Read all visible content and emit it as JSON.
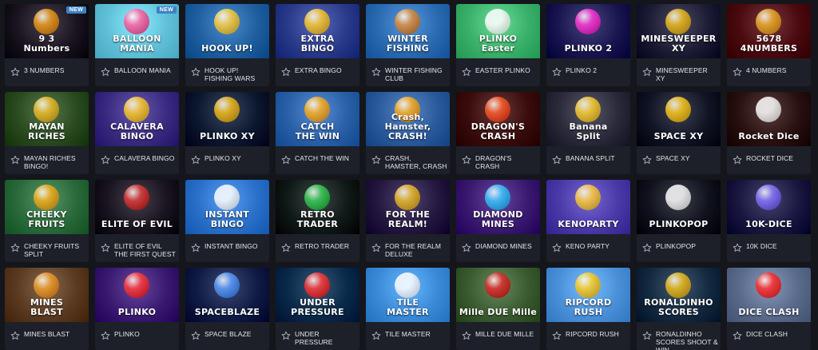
{
  "games": [
    {
      "label": "3 NUMBERS",
      "art": "9 3\nNumbers",
      "badge": "NEW",
      "bg": "#1a1420",
      "accent": "#f0a020"
    },
    {
      "label": "BALLOON MANIA",
      "art": "BALLOON\nMANIA",
      "badge": "NEW",
      "bg": "#5fc0d8",
      "accent": "#ff5fa0"
    },
    {
      "label": "HOOK UP! FISHING WARS",
      "art": "HOOK UP!",
      "badge": "",
      "bg": "#1f5fa0",
      "accent": "#ffd040"
    },
    {
      "label": "EXTRA BINGO",
      "art": "EXTRA\nBINGO",
      "badge": "",
      "bg": "#2a3a8a",
      "accent": "#ffcc30"
    },
    {
      "label": "WINTER FISHING CLUB",
      "art": "WINTER\nFISHING",
      "badge": "",
      "bg": "#2a6ab0",
      "accent": "#e09040"
    },
    {
      "label": "EASTER PLINKO",
      "art": "PLINKO\nEaster",
      "badge": "",
      "bg": "#3ab06a",
      "accent": "#ffffff"
    },
    {
      "label": "PLINKO 2",
      "art": "PLINKO 2",
      "badge": "",
      "bg": "#1a1650",
      "accent": "#ff3fd8"
    },
    {
      "label": "MINESWEEPER XY",
      "art": "MINESWEEPER XY",
      "badge": "",
      "bg": "#1c1c34",
      "accent": "#f0c020"
    },
    {
      "label": "4 NUMBERS",
      "art": "5678\n4NUMBERS",
      "badge": "",
      "bg": "#4a0a10",
      "accent": "#f0b030"
    },
    {
      "label": "MAYAN RICHES BINGO!",
      "art": "MAYAN\nRICHES",
      "badge": "",
      "bg": "#2a4a20",
      "accent": "#f0c030"
    },
    {
      "label": "CALAVERA BINGO",
      "art": "CALAVERA\nBINGO",
      "badge": "",
      "bg": "#3a2a80",
      "accent": "#ffcf30"
    },
    {
      "label": "PLINKO XY",
      "art": "PLINKO XY",
      "badge": "",
      "bg": "#0c1830",
      "accent": "#f5c020"
    },
    {
      "label": "CATCH THE WIN",
      "art": "CATCH\nTHE WIN",
      "badge": "",
      "bg": "#2a60a8",
      "accent": "#ffb020"
    },
    {
      "label": "CRASH, HAMSTER, CRASH",
      "art": "Crash, Hamster,\nCRASH!",
      "badge": "",
      "bg": "#2a5a9a",
      "accent": "#ffb020"
    },
    {
      "label": "DRAGON'S CRASH",
      "art": "DRAGON'S CRASH",
      "badge": "",
      "bg": "#3a0c0c",
      "accent": "#ff6030"
    },
    {
      "label": "BANANA SPLIT",
      "art": "Banana\nSplit",
      "badge": "",
      "bg": "#2a2a3a",
      "accent": "#ffd23a"
    },
    {
      "label": "SPACE XY",
      "art": "SPACE XY",
      "badge": "",
      "bg": "#101424",
      "accent": "#ffcc20"
    },
    {
      "label": "ROCKET DICE",
      "art": "Rocket Dice",
      "badge": "",
      "bg": "#2a1010",
      "accent": "#ffffff"
    },
    {
      "label": "CHEEKY FRUITS SPLIT",
      "art": "CHEEKY\nFRUITS",
      "badge": "",
      "bg": "#2a6a3a",
      "accent": "#f5b020"
    },
    {
      "label": "ELITE OF EVIL THE FIRST QUEST",
      "art": "ELITE OF EVIL",
      "badge": "",
      "bg": "#1a1420",
      "accent": "#e04040"
    },
    {
      "label": "INSTANT BINGO",
      "art": "INSTANT\nBINGO",
      "badge": "",
      "bg": "#2a70c8",
      "accent": "#ffffff"
    },
    {
      "label": "RETRO TRADER",
      "art": "RETRO\nTRADER",
      "badge": "",
      "bg": "#101a18",
      "accent": "#40d060"
    },
    {
      "label": "FOR THE REALM DELUXE",
      "art": "FOR THE\nREALM!",
      "badge": "",
      "bg": "#241840",
      "accent": "#f0c030"
    },
    {
      "label": "DIAMOND MINES",
      "art": "DIAMOND\nMINES",
      "badge": "",
      "bg": "#3a1a70",
      "accent": "#40c8ff"
    },
    {
      "label": "KENO PARTY",
      "art": "KENOPARTY",
      "badge": "",
      "bg": "#4a3aa8",
      "accent": "#ffd040"
    },
    {
      "label": "PLINKOPOP",
      "art": "PLINKOPOP",
      "badge": "",
      "bg": "#10121e",
      "accent": "#ffffff"
    },
    {
      "label": "10K DICE",
      "art": "10K-DICE",
      "badge": "",
      "bg": "#1a1840",
      "accent": "#8a7aff"
    },
    {
      "label": "MINES BLAST",
      "art": "MINES\nBLAST",
      "badge": "",
      "bg": "#5a3a20",
      "accent": "#f0a030"
    },
    {
      "label": "PLINKO",
      "art": "PLINKO",
      "badge": "",
      "bg": "#3a1a70",
      "accent": "#ff4040"
    },
    {
      "label": "SPACE BLAZE",
      "art": "SPACEBLAZE",
      "badge": "",
      "bg": "#101c44",
      "accent": "#60a0ff"
    },
    {
      "label": "UNDER PRESSURE",
      "art": "UNDER\nPRESSURE",
      "badge": "",
      "bg": "#0a2a4a",
      "accent": "#ff4040"
    },
    {
      "label": "TILE MASTER",
      "art": "TILE\nMASTER",
      "badge": "",
      "bg": "#3a8ad8",
      "accent": "#ffffff"
    },
    {
      "label": "MILLE DUE MILLE",
      "art": "Mille DUE Mille",
      "badge": "",
      "bg": "#3a5a30",
      "accent": "#e03030"
    },
    {
      "label": "RIPCORD RUSH",
      "art": "RIPCORD\nRUSH",
      "badge": "",
      "bg": "#4a90d8",
      "accent": "#ffcc20"
    },
    {
      "label": "RONALDINHO SCORES SHOOT & WIN",
      "art": "RONALDINHO\nSCORES",
      "badge": "",
      "bg": "#142a40",
      "accent": "#f0c020"
    },
    {
      "label": "DICE CLASH",
      "art": "DICE CLASH",
      "badge": "",
      "bg": "#5a6a8a",
      "accent": "#ff3030"
    }
  ],
  "ui": {
    "star_icon": "star-outline-icon",
    "star_color": "#a4a8b4",
    "card_bg": "#1d2029",
    "page_bg": "#14161c"
  }
}
